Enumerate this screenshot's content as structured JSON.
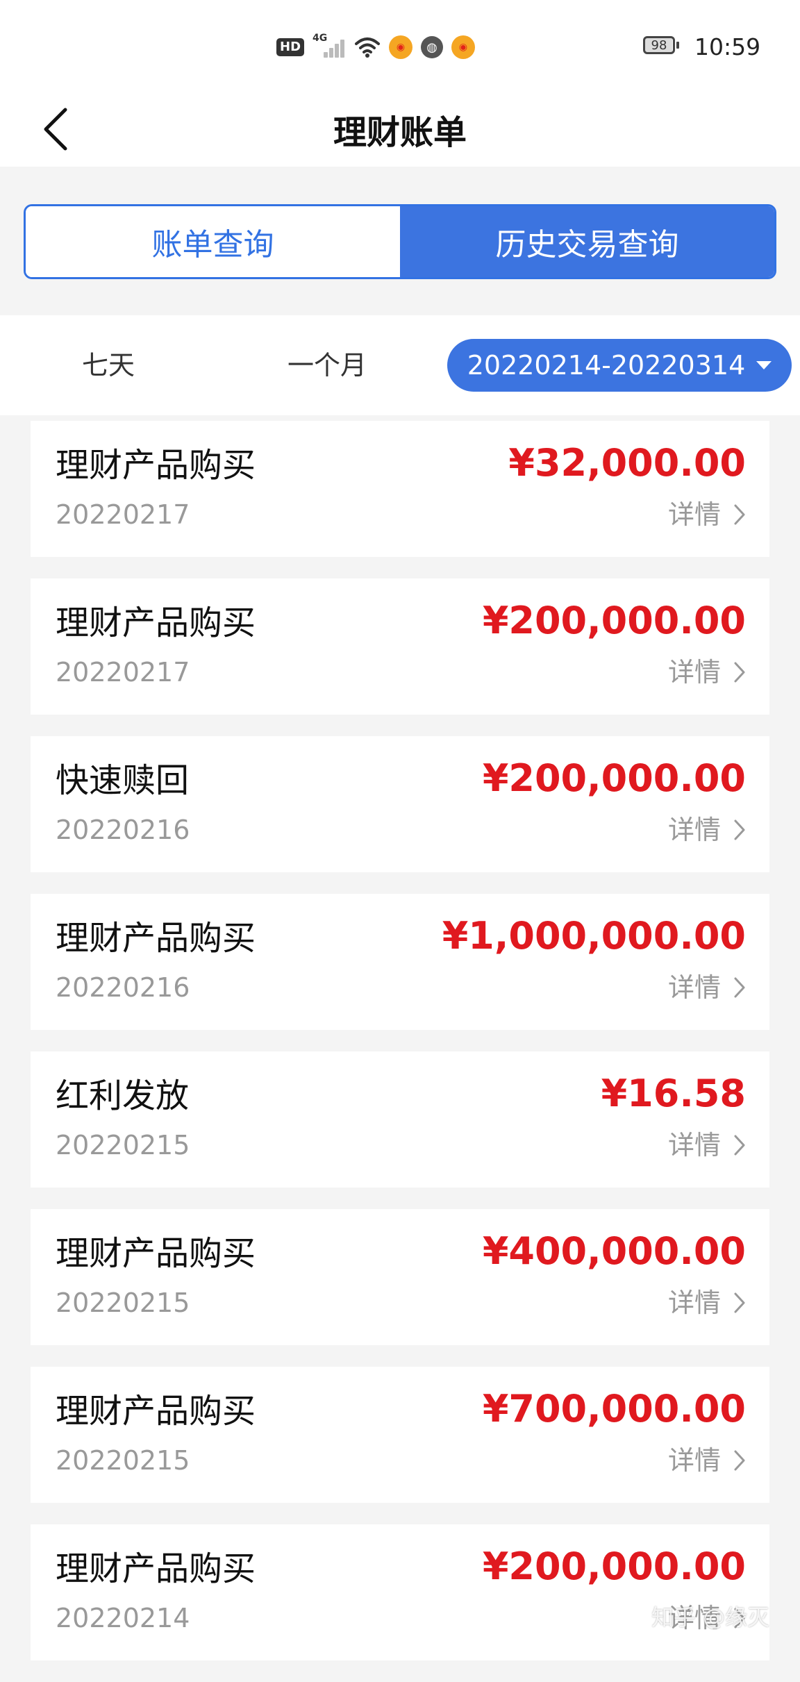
{
  "status_bar": {
    "hd": "HD",
    "network": "4G",
    "battery": "98",
    "time": "10:59"
  },
  "header": {
    "title": "理财账单"
  },
  "tabs": [
    {
      "label": "账单查询",
      "active": false
    },
    {
      "label": "历史交易查询",
      "active": true
    }
  ],
  "filters": {
    "seven_days": "七天",
    "one_month": "一个月",
    "date_range": "20220214-20220314"
  },
  "records": [
    {
      "title": "理财产品购买",
      "date": "20220217",
      "amount": "¥32,000.00",
      "detail": "详情"
    },
    {
      "title": "理财产品购买",
      "date": "20220217",
      "amount": "¥200,000.00",
      "detail": "详情"
    },
    {
      "title": "快速赎回",
      "date": "20220216",
      "amount": "¥200,000.00",
      "detail": "详情"
    },
    {
      "title": "理财产品购买",
      "date": "20220216",
      "amount": "¥1,000,000.00",
      "detail": "详情"
    },
    {
      "title": "红利发放",
      "date": "20220215",
      "amount": "¥16.58",
      "detail": "详情"
    },
    {
      "title": "理财产品购买",
      "date": "20220215",
      "amount": "¥400,000.00",
      "detail": "详情"
    },
    {
      "title": "理财产品购买",
      "date": "20220215",
      "amount": "¥700,000.00",
      "detail": "详情"
    },
    {
      "title": "理财产品购买",
      "date": "20220214",
      "amount": "¥200,000.00",
      "detail": "详情"
    }
  ],
  "watermark": "知乎 @缘灭",
  "colors": {
    "accent": "#3c74e0",
    "amount": "#e0191f",
    "muted": "#999999"
  }
}
